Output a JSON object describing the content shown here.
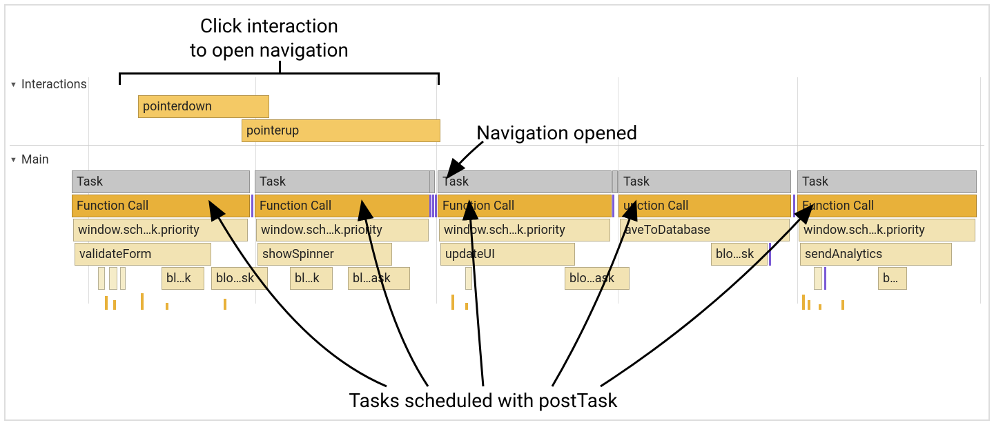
{
  "annotations": {
    "top": "Click interaction\nto open navigation",
    "nav_opened": "Navigation opened",
    "bottom": "Tasks scheduled with postTask"
  },
  "tracks": {
    "interactions_label": "Interactions",
    "main_label": "Main"
  },
  "interactions": {
    "pointerdown": "pointerdown",
    "pointerup": "pointerup"
  },
  "tasks": [
    {
      "task_label": "Task",
      "fn_label": "Function Call",
      "row3": "window.sch…k.priority",
      "row4": "validateForm",
      "row5_items": [
        "bl…k",
        "blo…sk"
      ]
    },
    {
      "task_label": "Task",
      "fn_label": "Function Call",
      "row3": "window.sch…k.priority",
      "row4": "showSpinner",
      "row5_items": [
        "bl…k",
        "bl…ask"
      ]
    },
    {
      "task_label": "Task",
      "fn_label": "Function Call",
      "row3": "window.sch…k.priority",
      "row4": "updateUI",
      "row5_items": [
        "blo…ask"
      ]
    },
    {
      "task_label": "Task",
      "fn_label": "unction Call",
      "row3": "aveToDatabase",
      "row4": "blo…sk",
      "row5_items": []
    },
    {
      "task_label": "Task",
      "fn_label": "Function Call",
      "row3": "window.sch…k.priority",
      "row4": "sendAnalytics",
      "row5_items": [
        "b…"
      ]
    }
  ]
}
